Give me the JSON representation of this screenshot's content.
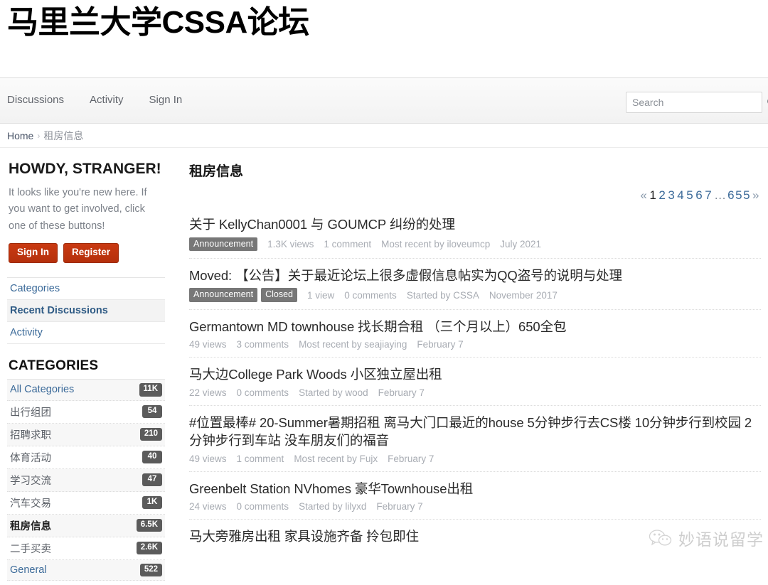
{
  "site": {
    "title": "马里兰大学CSSA论坛"
  },
  "nav": {
    "items": [
      {
        "label": "Discussions",
        "name": "nav-discussions"
      },
      {
        "label": "Activity",
        "name": "nav-activity"
      },
      {
        "label": "Sign In",
        "name": "nav-sign-in"
      }
    ],
    "search": {
      "placeholder": "Search",
      "value": "",
      "icon": "search-icon"
    }
  },
  "breadcrumb": {
    "home": "Home",
    "separator": "›",
    "current": "租房信息"
  },
  "sidebar": {
    "guest": {
      "heading": "HOWDY, STRANGER!",
      "text": "It looks like you're new here. If you want to get involved, click one of these buttons!",
      "sign_in": "Sign In",
      "register": "Register",
      "button_color": "#c1330e"
    },
    "nav_items": [
      {
        "label": "Categories",
        "active": false
      },
      {
        "label": "Recent Discussions",
        "active": true
      },
      {
        "label": "Activity",
        "active": false
      }
    ],
    "categories_heading": "CATEGORIES",
    "categories": [
      {
        "label": "All Categories",
        "count": "11K",
        "latin": true,
        "active": false
      },
      {
        "label": "出行组团",
        "count": "54",
        "latin": false,
        "active": false
      },
      {
        "label": "招聘求职",
        "count": "210",
        "latin": false,
        "active": false
      },
      {
        "label": "体育活动",
        "count": "40",
        "latin": false,
        "active": false
      },
      {
        "label": "学习交流",
        "count": "47",
        "latin": false,
        "active": false
      },
      {
        "label": "汽车交易",
        "count": "1K",
        "latin": false,
        "active": false
      },
      {
        "label": "租房信息",
        "count": "6.5K",
        "latin": false,
        "active": true
      },
      {
        "label": "二手买卖",
        "count": "2.6K",
        "latin": false,
        "active": false
      },
      {
        "label": "General",
        "count": "522",
        "latin": true,
        "active": false
      }
    ],
    "badge_color": "#5b5b5b"
  },
  "main": {
    "title": "租房信息",
    "pagination": {
      "prev": "«",
      "pages": [
        "1",
        "2",
        "3",
        "4",
        "5",
        "6",
        "7"
      ],
      "current": "1",
      "ellipsis": "…",
      "last": "655",
      "next": "»"
    },
    "discussions": [
      {
        "title": "关于 KellyChan0001 与 GOUMCP 纠纷的处理",
        "tags": [
          "Announcement"
        ],
        "views": "1.3K views",
        "comments": "1 comment",
        "author": "Most recent by iloveumcp",
        "date": "July 2021"
      },
      {
        "title": "Moved: 【公告】关于最近论坛上很多虚假信息帖实为QQ盗号的说明与处理",
        "tags": [
          "Announcement",
          "Closed"
        ],
        "views": "1 view",
        "comments": "0 comments",
        "author": "Started by CSSA",
        "date": "November 2017"
      },
      {
        "title": "Germantown MD townhouse 找长期合租 （三个月以上）650全包",
        "tags": [],
        "views": "49 views",
        "comments": "3 comments",
        "author": "Most recent by seajiaying",
        "date": "February 7"
      },
      {
        "title": "马大边College Park Woods 小区独立屋出租",
        "tags": [],
        "views": "22 views",
        "comments": "0 comments",
        "author": "Started by wood",
        "date": "February 7"
      },
      {
        "title": "#位置最棒# 20-Summer暑期招租 离马大门口最近的house 5分钟步行去CS楼 10分钟步行到校园 2分钟步行到车站 没车朋友们的福音",
        "tags": [],
        "views": "49 views",
        "comments": "1 comment",
        "author": "Most recent by Fujx",
        "date": "February 7"
      },
      {
        "title": "Greenbelt Station NVhomes 豪华Townhouse出租",
        "tags": [],
        "views": "24 views",
        "comments": "0 comments",
        "author": "Started by lilyxd",
        "date": "February 7"
      },
      {
        "title": "马大旁雅房出租 家具设施齐备 拎包即住",
        "tags": [],
        "views": "",
        "comments": "",
        "author": "",
        "date": ""
      }
    ]
  },
  "watermark": {
    "text": "妙语说留学",
    "icon": "wechat-icon"
  }
}
